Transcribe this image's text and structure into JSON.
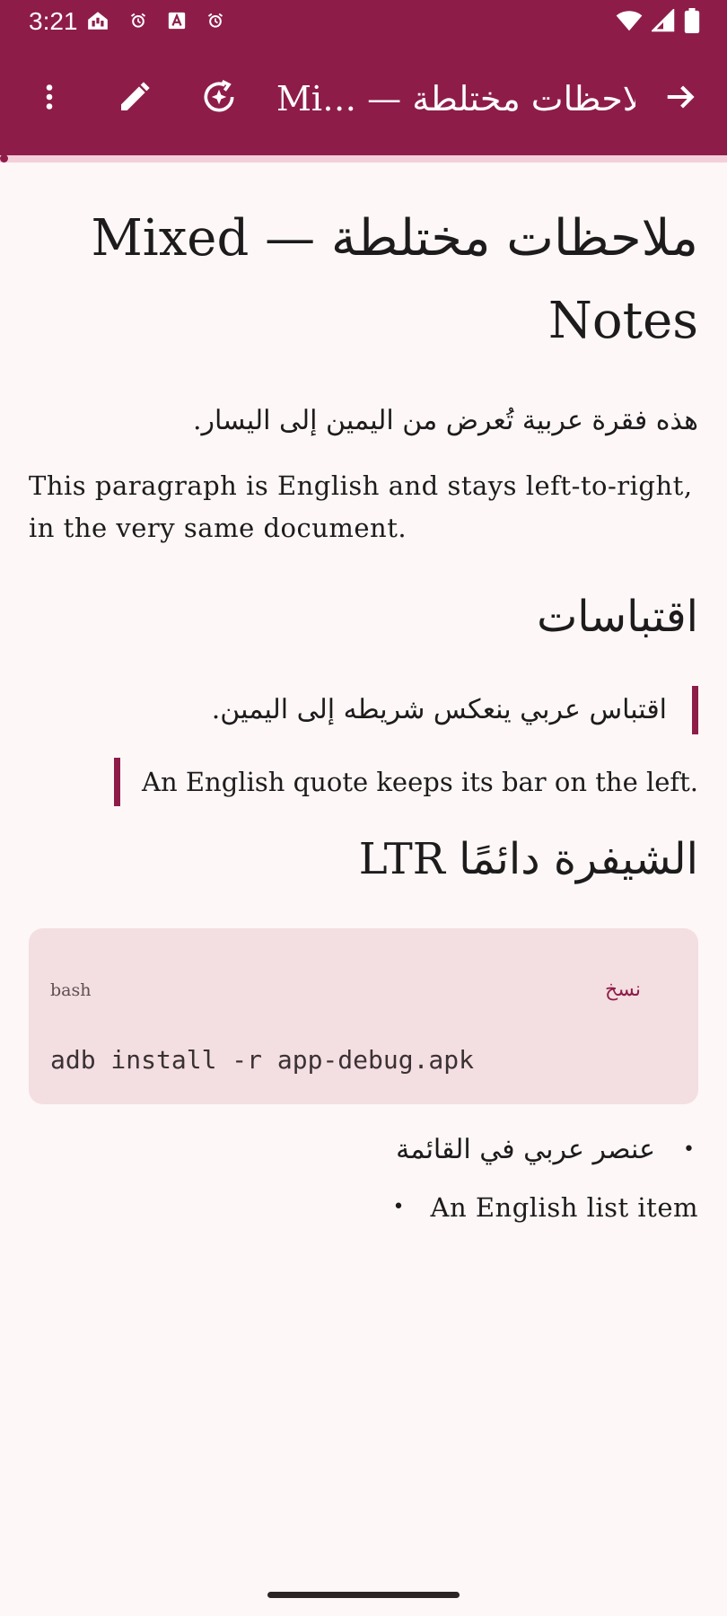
{
  "status": {
    "time": "3:21",
    "left_icons": [
      "home-alert-icon",
      "alarm-icon",
      "a-badge-icon",
      "alarm-icon"
    ],
    "right_icons": [
      "wifi-icon",
      "cellular-icon",
      "battery-icon"
    ]
  },
  "appbar": {
    "title": "Mi… — ملاحظات مختلطة",
    "icons": [
      "more-vert-icon",
      "edit-icon",
      "sparkle-sync-icon",
      "arrow-forward-icon"
    ]
  },
  "document": {
    "title": "ملاحظات مختلطة — Mixed Notes",
    "para_ar": "هذه فقرة عربية تُعرض من اليمين إلى اليسار.",
    "para_en": "This paragraph is English and stays left-to-right, in the very same document.",
    "h2_quotes": "اقتباسات",
    "quote_ar": "اقتباس عربي ينعكس شريطه إلى اليمين.",
    "quote_en": "An English quote keeps its bar on the left.",
    "h2_code": "الشيفرة دائمًا LTR",
    "code": {
      "lang": "bash",
      "copy_label": "نسخ",
      "text": "adb install -r app-debug.apk"
    },
    "list": {
      "item_ar": "عنصر عربي في القائمة",
      "item_en": "An English list item",
      "bullet": "•"
    }
  },
  "colors": {
    "primary": "#8e1c49",
    "background": "#fdf7f7",
    "progress_track": "#f4cfd9",
    "code_bg": "#f3dee1"
  }
}
